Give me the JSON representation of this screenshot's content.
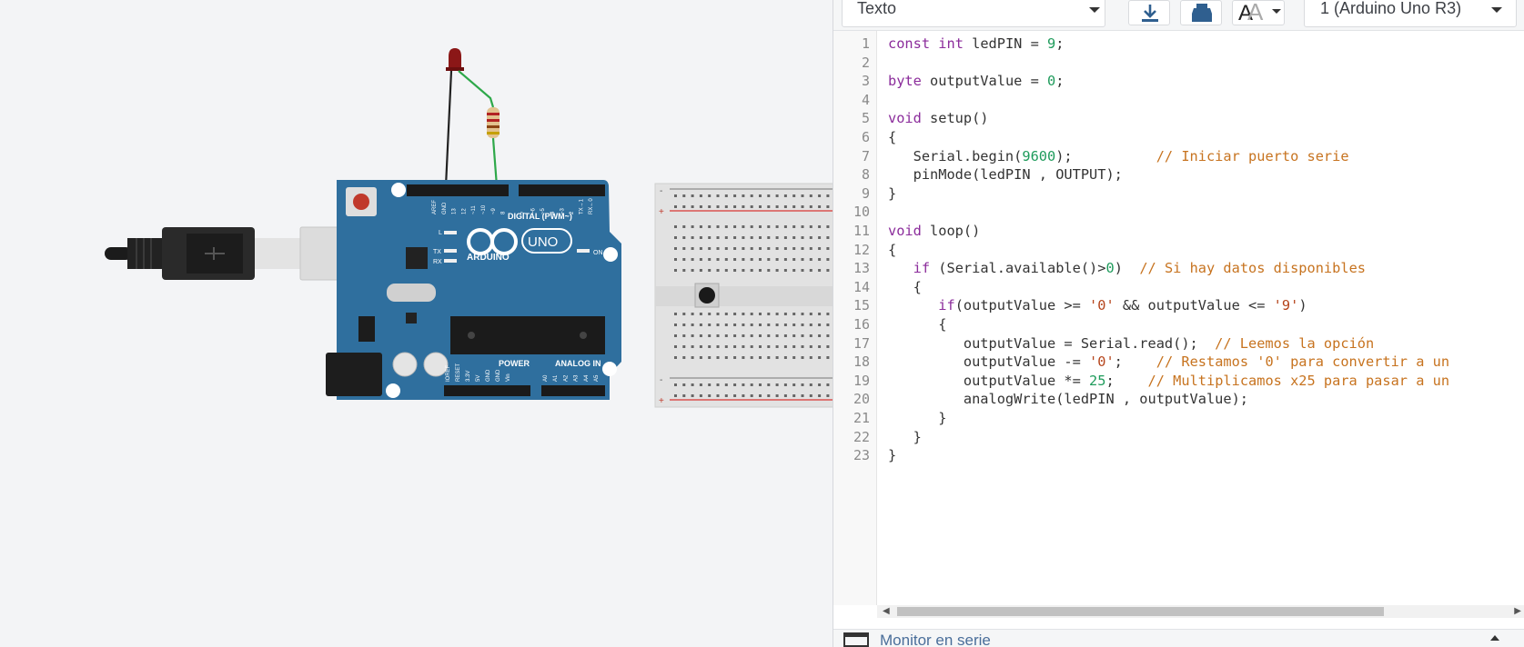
{
  "toolbar": {
    "mode_label": "Texto",
    "board_label": "1 (Arduino Uno R3)",
    "font_icon_label": "A"
  },
  "icons": {
    "download": "download-icon",
    "upload": "upload-icon",
    "font_size": "font-size-icon",
    "serial": "serial-monitor-icon"
  },
  "breadboard_icon": "pushbutton",
  "arduino_labels": {
    "brand": "ARDUINO",
    "model": "UNO",
    "digital": "DIGITAL (PWM~)",
    "power": "POWER",
    "analog": "ANALOG IN",
    "on": "ON",
    "led_l": "L",
    "tx": "TX",
    "rx": "RX",
    "digital_pins": [
      "AREF",
      "GND",
      "13",
      "12",
      "~11",
      "~10",
      "~9",
      "8",
      "7",
      "~6",
      "~5",
      "4",
      "~3",
      "2",
      "TX→1",
      "RX←0"
    ],
    "power_pins": [
      "IOREF",
      "RESET",
      "3.3V",
      "5V",
      "GND",
      "GND",
      "Vin"
    ],
    "analog_pins": [
      "A0",
      "A1",
      "A2",
      "A3",
      "A4",
      "A5"
    ]
  },
  "code": {
    "line_numbers": [
      "1",
      "2",
      "3",
      "4",
      "5",
      "6",
      "7",
      "8",
      "9",
      "10",
      "11",
      "12",
      "13",
      "14",
      "15",
      "16",
      "17",
      "18",
      "19",
      "20",
      "21",
      "22",
      "23"
    ],
    "lines": [
      "const int ledPIN = 9;",
      "",
      "byte outputValue = 0;",
      "",
      "void setup()",
      "{",
      "   Serial.begin(9600);          // Iniciar puerto serie",
      "   pinMode(ledPIN , OUTPUT);",
      "}",
      "",
      "void loop()",
      "{",
      "   if (Serial.available()>0)  // Si hay datos disponibles",
      "   {",
      "      if(outputValue >= '0' && outputValue <= '9')",
      "      {",
      "         outputValue = Serial.read();  // Leemos la opción",
      "         outputValue -= '0';    // Restamos '0' para convertir a un",
      "         outputValue *= 25;    // Multiplicamos x25 para pasar a un",
      "         analogWrite(ledPIN , outputValue);",
      "      }",
      "   }",
      "}"
    ]
  },
  "serial_monitor_label": "Monitor en serie",
  "colors": {
    "keyword": "#8b2c9b",
    "number": "#1e9b5b",
    "string": "#b5441b",
    "comment": "#c7731f",
    "arduino_board": "#2f6f9e",
    "led_red": "#8b1717"
  }
}
